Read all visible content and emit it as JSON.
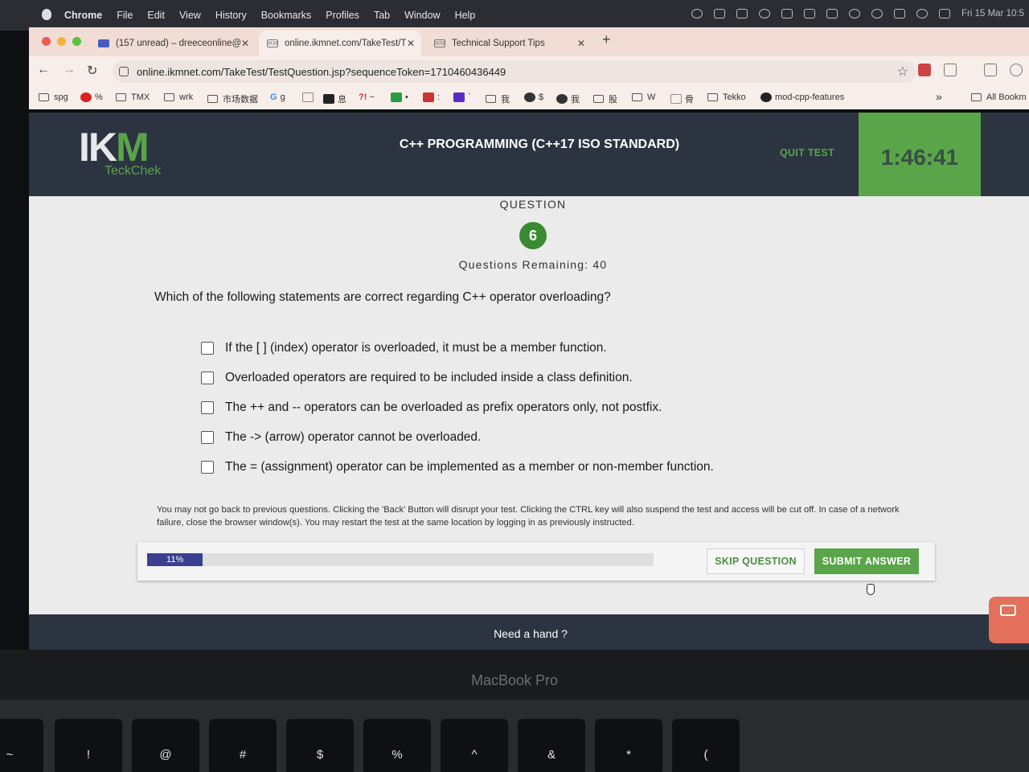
{
  "menubar": {
    "app_name": "Chrome",
    "menus": [
      "File",
      "Edit",
      "View",
      "History",
      "Bookmarks",
      "Profiles",
      "Tab",
      "Window",
      "Help"
    ],
    "clock": "Fri 15 Mar  10:5"
  },
  "tabs": [
    {
      "title": "(157 unread) – dreeceonline@",
      "icon": "mail-icon"
    },
    {
      "title": "online.ikmnet.com/TakeTest/T",
      "icon": "ikm-favicon",
      "active": true
    },
    {
      "title": "Technical Support Tips",
      "icon": "ikm-favicon"
    }
  ],
  "toolbar": {
    "url": "online.ikmnet.com/TakeTest/TestQuestion.jsp?sequenceToken=1710460436449"
  },
  "bookmarks": {
    "spg": "spg",
    "pct": "%",
    "tmx": "TMX",
    "wrk": "wrk",
    "market": "市场数据",
    "g": "g",
    "info": "息",
    "tilde": "~",
    "dot": "•",
    "colon": ":",
    "quote": "`",
    "me1": "我",
    "dollar": "$",
    "me2": "我",
    "stock": "股",
    "w": "W",
    "bone": "骨",
    "tekko": "Tekko",
    "mod": "mod-cpp-features",
    "overflow": "»",
    "all": "All Bookm"
  },
  "header": {
    "logo_main": "IK",
    "logo_m": "M",
    "logo_sub": "TeckChek",
    "course_title": "C++ PROGRAMMING (C++17 ISO STANDARD)",
    "quit_label": "QUIT TEST",
    "timer": "1:46:41"
  },
  "question": {
    "label": "QUESTION",
    "number": "6",
    "remaining": "Questions Remaining: 40",
    "text": "Which of the following statements are correct regarding C++ operator overloading?",
    "options": [
      "If the [ ] (index) operator is overloaded, it must be a member function.",
      "Overloaded operators are required to be included inside a class definition.",
      "The ++ and -- operators can be overloaded as prefix operators only, not postfix.",
      "The -> (arrow) operator cannot be overloaded.",
      "The = (assignment) operator can be implemented as a member or non-member function."
    ]
  },
  "notice": "You may not go back to previous questions. Clicking the 'Back' Button will disrupt your test. Clicking the CTRL key will also suspend the test and access will be cut off. In case of a network failure, close the browser window(s). You may restart the test at the same location by logging in as previously instructed.",
  "progress": {
    "label": "11%",
    "fraction": 0.11
  },
  "actions": {
    "skip": "SKIP QUESTION",
    "submit": "SUBMIT ANSWER"
  },
  "footer": {
    "help": "Need a hand ?"
  },
  "device": {
    "label": "MacBook Pro"
  },
  "keys": [
    "~",
    "!",
    "@",
    "#",
    "$",
    "%",
    "^",
    "&",
    "*",
    "("
  ],
  "colors": {
    "brand_green": "#5aa449",
    "header_navy": "#2c3442",
    "progress_blue": "#3a3f8f"
  }
}
